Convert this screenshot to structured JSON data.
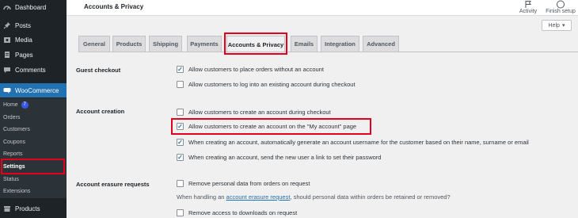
{
  "sidebar": {
    "items": [
      {
        "label": "Dashboard",
        "icon": "dashboard-icon"
      },
      {
        "label": "Posts",
        "icon": "pin-icon"
      },
      {
        "label": "Media",
        "icon": "media-icon"
      },
      {
        "label": "Pages",
        "icon": "page-icon"
      },
      {
        "label": "Comments",
        "icon": "comment-icon"
      },
      {
        "label": "WooCommerce",
        "icon": "woo-icon"
      }
    ],
    "submenu": [
      {
        "label": "Home",
        "badge": "7"
      },
      {
        "label": "Orders"
      },
      {
        "label": "Customers"
      },
      {
        "label": "Coupons"
      },
      {
        "label": "Reports"
      },
      {
        "label": "Settings"
      },
      {
        "label": "Status"
      },
      {
        "label": "Extensions"
      }
    ],
    "products": {
      "label": "Products",
      "icon": "archive-icon"
    }
  },
  "header": {
    "title": "Accounts & Privacy",
    "activity": "Activity",
    "finish_setup": "Finish setup"
  },
  "help": {
    "label": "Help"
  },
  "tabs": [
    "General",
    "Products",
    "Shipping",
    "Payments",
    "Accounts & Privacy",
    "Emails",
    "Integration",
    "Advanced"
  ],
  "active_tab": "Accounts & Privacy",
  "sections": {
    "guest_checkout": {
      "label": "Guest checkout",
      "options": [
        {
          "label": "Allow customers to place orders without an account",
          "checked": true
        },
        {
          "label": "Allow customers to log into an existing account during checkout",
          "checked": false
        }
      ]
    },
    "account_creation": {
      "label": "Account creation",
      "options": [
        {
          "label": "Allow customers to create an account during checkout",
          "checked": false
        },
        {
          "label": "Allow customers to create an account on the \"My account\" page",
          "checked": true
        },
        {
          "label": "When creating an account, automatically generate an account username for the customer based on their name, surname or email",
          "checked": true
        },
        {
          "label": "When creating an account, send the new user a link to set their password",
          "checked": true
        }
      ]
    },
    "account_erasure": {
      "label": "Account erasure requests",
      "options": [
        {
          "label": "Remove personal data from orders on request",
          "checked": false
        },
        {
          "label": "Remove access to downloads on request",
          "checked": false
        }
      ],
      "description_pre": "When handling an ",
      "description_link": "account erasure request",
      "description_post": ", should personal data within orders be retained or removed?"
    }
  },
  "colors": {
    "highlight": "#e4001b",
    "accent": "#2271b1",
    "sidebar": "#1d2327"
  }
}
